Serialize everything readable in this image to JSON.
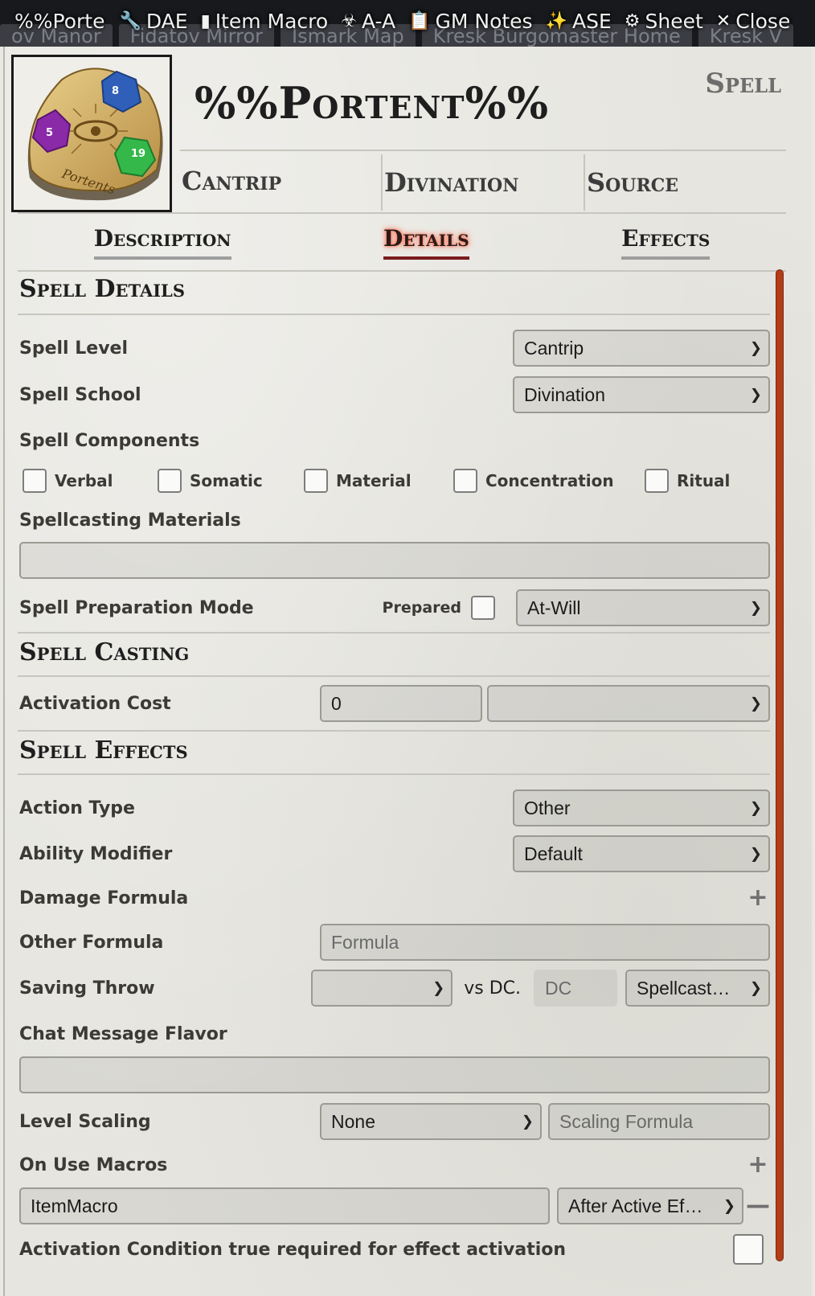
{
  "header": {
    "title": "%%Porte",
    "buttons": [
      {
        "label": "DAE",
        "icon": "wrench-icon"
      },
      {
        "label": "Item Macro",
        "icon": "sd-card-icon"
      },
      {
        "label": "A-A",
        "icon": "biohazard-icon"
      },
      {
        "label": "GM Notes",
        "icon": "clipboard-icon"
      },
      {
        "label": "ASE",
        "icon": "magic-wand-icon"
      },
      {
        "label": "Sheet",
        "icon": "gear-icon"
      },
      {
        "label": "Close",
        "icon": "close-icon"
      }
    ],
    "scene_tabs": [
      "ov Manor",
      "Fidatov Mirror",
      "Ismark Map",
      "Kresk Burgomaster Home",
      "Kresk V"
    ]
  },
  "item": {
    "name": "%%Portent%%",
    "type": "Spell",
    "summary": [
      "Cantrip",
      "Divination",
      "Source"
    ],
    "image_label": "Portents"
  },
  "tabs": [
    {
      "label": "Description",
      "active": false
    },
    {
      "label": "Details",
      "active": true
    },
    {
      "label": "Effects",
      "active": false
    }
  ],
  "spell_details": {
    "header": "Spell Details",
    "level_label": "Spell Level",
    "level_value": "Cantrip",
    "school_label": "Spell School",
    "school_value": "Divination",
    "components_label": "Spell Components",
    "components": [
      "Verbal",
      "Somatic",
      "Material",
      "Concentration",
      "Ritual"
    ],
    "materials_label": "Spellcasting Materials",
    "materials_value": "",
    "prep_label": "Spell Preparation Mode",
    "prepared_label": "Prepared",
    "prep_value": "At-Will"
  },
  "spell_casting": {
    "header": "Spell Casting",
    "activation_label": "Activation Cost",
    "activation_cost": "0",
    "activation_type": ""
  },
  "spell_effects": {
    "header": "Spell Effects",
    "action_type_label": "Action Type",
    "action_type_value": "Other",
    "ability_label": "Ability Modifier",
    "ability_value": "Default",
    "damage_label": "Damage Formula",
    "other_label": "Other Formula",
    "other_placeholder": "Formula",
    "save_label": "Saving Throw",
    "save_value": "",
    "vs_dc": "vs DC.",
    "dc_placeholder": "DC",
    "dc_source": "Spellcast…",
    "flavor_label": "Chat Message Flavor",
    "flavor_value": "",
    "scaling_label": "Level Scaling",
    "scaling_value": "None",
    "scaling_placeholder": "Scaling Formula",
    "macros_label": "On Use Macros",
    "macro_value": "ItemMacro",
    "macro_timing": "After Active Ef…",
    "activation_condition_label": "Activation Condition true required for effect activation"
  },
  "colors": {
    "header_bg": "#17191c",
    "parchment": "#e6e5df",
    "accent_red": "#7a1c1c",
    "scrollbar": "#b23d18"
  }
}
